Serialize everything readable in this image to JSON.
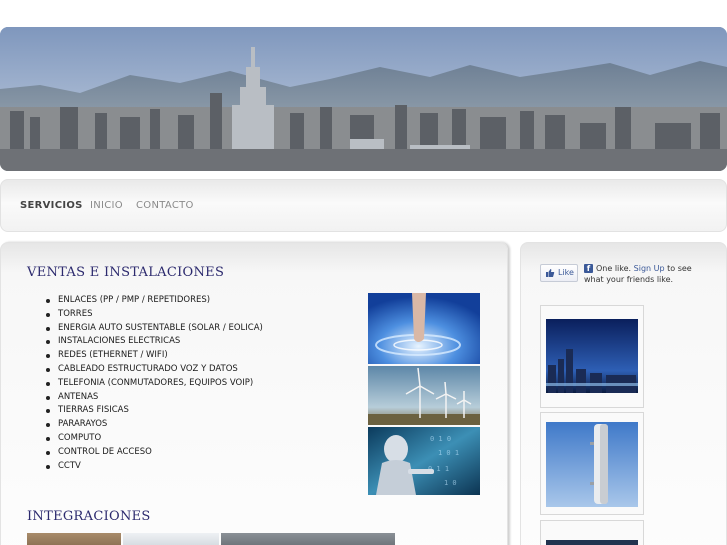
{
  "nav": {
    "items": [
      {
        "label": "SERVICIOS",
        "active": true
      },
      {
        "label": "INICIO",
        "active": false
      },
      {
        "label": "CONTACTO",
        "active": false
      }
    ]
  },
  "main": {
    "section1_title": "VENTAS E INSTALACIONES",
    "services": [
      "ENLACES (PP / PMP / REPETIDORES)",
      "TORRES",
      "ENERGIA AUTO SUSTENTABLE (SOLAR / EOLICA)",
      "INSTALACIONES ELECTRICAS",
      "REDES (ETHERNET / WIFI)",
      "CABLEADO ESTRUCTURADO VOZ Y DATOS",
      "TELEFONIA (CONMUTADORES, EQUIPOS VOIP)",
      "ANTENAS",
      "TIERRAS FISICAS",
      "PARARAYOS",
      "COMPUTO",
      "CONTROL DE ACCESO",
      "CCTV"
    ],
    "section2_title": "INTEGRACIONES"
  },
  "sidebar": {
    "like_label": "Like",
    "fb_text_before": "One like.",
    "fb_signup_link": "Sign Up",
    "fb_text_after": "to see what your friends like."
  },
  "colors": {
    "title": "#2c2a6e",
    "fb_blue": "#3b5998"
  }
}
